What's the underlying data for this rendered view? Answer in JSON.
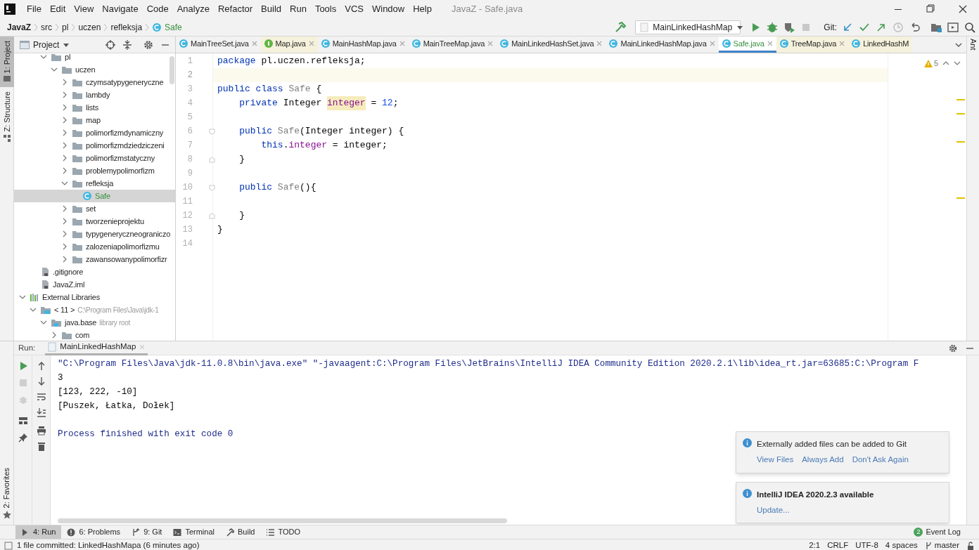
{
  "window": {
    "title": "JavaZ - Safe.java"
  },
  "menu": [
    "File",
    "Edit",
    "View",
    "Navigate",
    "Code",
    "Analyze",
    "Refactor",
    "Build",
    "Run",
    "Tools",
    "VCS",
    "Window",
    "Help"
  ],
  "breadcrumbs": [
    {
      "label": "JavaZ",
      "kind": "project"
    },
    {
      "label": "src",
      "kind": "dir"
    },
    {
      "label": "pl",
      "kind": "dir"
    },
    {
      "label": "uczen",
      "kind": "dir"
    },
    {
      "label": "refleksja",
      "kind": "dir"
    },
    {
      "label": "Safe",
      "kind": "class"
    }
  ],
  "run_config": "MainLinkedHashMap",
  "git_label": "Git:",
  "left_stripe": [
    {
      "label": "1: Project",
      "selected": true
    },
    {
      "label": "Z: Structure",
      "selected": false
    }
  ],
  "favorites_label": "2: Favorites",
  "right_stripe": "Ant",
  "project_panel": {
    "title": "Project"
  },
  "tree": {
    "scrolled_items": [
      {
        "label": "pl",
        "kind": "folder",
        "expanded": true,
        "selected": false,
        "children": [
          {
            "label": "uczen",
            "kind": "folder",
            "expanded": true,
            "selected": false,
            "children": [
              {
                "label": "czymsatypygeneryczne",
                "kind": "folder",
                "expanded": false,
                "selected": false
              },
              {
                "label": "lambdy",
                "kind": "folder",
                "expanded": false,
                "selected": false
              },
              {
                "label": "lists",
                "kind": "folder",
                "expanded": false,
                "selected": false
              },
              {
                "label": "map",
                "kind": "folder",
                "expanded": false,
                "selected": false
              },
              {
                "label": "polimorfizmdynamiczny",
                "kind": "folder",
                "expanded": false,
                "selected": false
              },
              {
                "label": "polimorfizmdziedziczeni",
                "kind": "folder",
                "expanded": false,
                "selected": false
              },
              {
                "label": "polimorfizmstatyczny",
                "kind": "folder",
                "expanded": false,
                "selected": false
              },
              {
                "label": "problemypolimorfizm",
                "kind": "folder",
                "expanded": false,
                "selected": false
              },
              {
                "label": "refleksja",
                "kind": "folder",
                "expanded": true,
                "selected": false,
                "children": [
                  {
                    "label": "Safe",
                    "kind": "class",
                    "selected": true
                  }
                ]
              },
              {
                "label": "set",
                "kind": "folder",
                "expanded": false,
                "selected": false
              },
              {
                "label": "tworzenieprojektu",
                "kind": "folder",
                "expanded": false,
                "selected": false
              },
              {
                "label": "typygeneryczneograniczo",
                "kind": "folder",
                "expanded": false,
                "selected": false
              },
              {
                "label": "zalozeniapolimorfizmu",
                "kind": "folder",
                "expanded": false,
                "selected": false
              },
              {
                "label": "zawansowanypolimorfizr",
                "kind": "folder",
                "expanded": false,
                "selected": false
              }
            ]
          }
        ]
      }
    ],
    "project_files": [
      {
        "label": ".gitignore",
        "kind": "file",
        "selected": false
      },
      {
        "label": "JavaZ.iml",
        "kind": "file",
        "selected": false
      }
    ],
    "libraries": [
      {
        "label": "External Libraries",
        "kind": "library",
        "expanded": true,
        "selected": false,
        "children": [
          {
            "label": "< 11 >",
            "note": "C:\\Program Files\\Java\\jdk-1",
            "kind": "jdk",
            "expanded": true,
            "selected": false,
            "children": [
              {
                "label": "java.base",
                "note": "library root",
                "kind": "module",
                "expanded": true,
                "selected": false,
                "children": [
                  {
                    "label": "com",
                    "kind": "folder",
                    "expanded": false,
                    "selected": false
                  }
                ]
              }
            ]
          }
        ]
      }
    ]
  },
  "tabs": [
    {
      "label": "MainTreeSet.java",
      "kind": "class",
      "library": false,
      "selected": false
    },
    {
      "label": "Map.java",
      "kind": "interface",
      "library": true,
      "selected": false
    },
    {
      "label": "MainHashMap.java",
      "kind": "class",
      "library": false,
      "selected": false
    },
    {
      "label": "MainTreeMap.java",
      "kind": "class",
      "library": false,
      "selected": false
    },
    {
      "label": "MainLinkedHashSet.java",
      "kind": "class",
      "library": false,
      "selected": false
    },
    {
      "label": "MainLinkedHashMap.java",
      "kind": "class",
      "library": false,
      "selected": false
    },
    {
      "label": "Safe.java",
      "kind": "class",
      "library": false,
      "selected": true
    },
    {
      "label": "TreeMap.java",
      "kind": "class",
      "library": true,
      "selected": false
    },
    {
      "label": "LinkedHashM",
      "kind": "class",
      "library": true,
      "selected": false,
      "cut": true
    }
  ],
  "warnings": "5",
  "code": [
    {
      "number": "1",
      "kind": "plain",
      "current": false,
      "tokens": [
        {
          "text": "package ",
          "kind": "keyword"
        },
        {
          "text": "pl.uczen.refleksja;",
          "kind": "plain"
        }
      ]
    },
    {
      "number": "2",
      "kind": "plain",
      "current": true
    },
    {
      "number": "3",
      "kind": "plain",
      "current": false,
      "tokens": [
        {
          "text": "public class ",
          "kind": "keyword"
        },
        {
          "text": "Safe",
          "kind": "unused"
        },
        {
          "text": " {",
          "kind": "plain"
        }
      ]
    },
    {
      "number": "4",
      "kind": "plain",
      "current": false,
      "tokens": [
        {
          "text": "    private ",
          "kind": "keyword"
        },
        {
          "text": "Integer ",
          "kind": "plain"
        },
        {
          "text": "integer",
          "kind": "field_marked"
        },
        {
          "text": " = ",
          "kind": "plain"
        },
        {
          "text": "12",
          "kind": "number"
        },
        {
          "text": ";",
          "kind": "plain"
        }
      ]
    },
    {
      "number": "5",
      "kind": "plain",
      "current": false
    },
    {
      "number": "6",
      "kind": "foldstart",
      "current": false,
      "tokens": [
        {
          "text": "    public ",
          "kind": "keyword"
        },
        {
          "text": "Safe",
          "kind": "unused"
        },
        {
          "text": "(Integer integer) {",
          "kind": "plain"
        }
      ]
    },
    {
      "number": "7",
      "kind": "plain",
      "current": false,
      "tokens": [
        {
          "text": "        this",
          "kind": "keyword"
        },
        {
          "text": ".",
          "kind": "plain"
        },
        {
          "text": "integer",
          "kind": "field"
        },
        {
          "text": " = integer;",
          "kind": "plain"
        }
      ]
    },
    {
      "number": "8",
      "kind": "foldend",
      "current": false,
      "tokens": [
        {
          "text": "    }",
          "kind": "plain"
        }
      ]
    },
    {
      "number": "9",
      "kind": "plain",
      "current": false
    },
    {
      "number": "10",
      "kind": "foldstart",
      "current": false,
      "tokens": [
        {
          "text": "    public ",
          "kind": "keyword"
        },
        {
          "text": "Safe",
          "kind": "unused"
        },
        {
          "text": "(){",
          "kind": "plain"
        }
      ]
    },
    {
      "number": "11",
      "kind": "plain",
      "current": false
    },
    {
      "number": "12",
      "kind": "foldend",
      "current": false,
      "tokens": [
        {
          "text": "    }",
          "kind": "plain"
        }
      ]
    },
    {
      "number": "13",
      "kind": "plain",
      "current": false,
      "tokens": [
        {
          "text": "}",
          "kind": "plain"
        }
      ]
    },
    {
      "number": "14",
      "kind": "plain",
      "current": false
    }
  ],
  "run_panel": {
    "label": "Run:",
    "tab": "MainLinkedHashMap",
    "console": [
      {
        "text": "\"C:\\Program Files\\Java\\jdk-11.0.8\\bin\\java.exe\" \"-javaagent:C:\\Program Files\\JetBrains\\IntelliJ IDEA Community Edition 2020.2.1\\lib\\idea_rt.jar=63685:C:\\Program F",
        "kind": "system"
      },
      {
        "text": "3",
        "kind": "output"
      },
      {
        "text": "[123, 222, -10]",
        "kind": "output"
      },
      {
        "text": "[Puszek, Łatka, Dołek]",
        "kind": "output"
      },
      {
        "kind": "blank"
      },
      {
        "text": "Process finished with exit code 0",
        "kind": "system"
      }
    ]
  },
  "notifications": [
    {
      "title": "Externally added files can be added to Git",
      "bold": false,
      "links": [
        "View Files",
        "Always Add",
        "Don't Ask Again"
      ]
    },
    {
      "title": "IntelliJ IDEA 2020.2.3 available",
      "bold": true,
      "links": [
        "Update..."
      ]
    }
  ],
  "tool_tabs": [
    {
      "label": "4: Run",
      "kind": "run",
      "selected": true
    },
    {
      "label": "6: Problems",
      "kind": "problems",
      "selected": false
    },
    {
      "label": "9: Git",
      "kind": "git",
      "selected": false
    },
    {
      "label": "Terminal",
      "kind": "terminal",
      "selected": false
    },
    {
      "label": "Build",
      "kind": "build",
      "selected": false
    },
    {
      "label": "TODO",
      "kind": "todo",
      "selected": false
    }
  ],
  "event_log": {
    "label": "Event Log",
    "count": "2"
  },
  "status_bar": {
    "message": "1 file committed: LinkedHashMapa (6 minutes ago)",
    "items": [
      "2:1",
      "CRLF",
      "UTF-8",
      "4 spaces"
    ],
    "branch": "master"
  }
}
